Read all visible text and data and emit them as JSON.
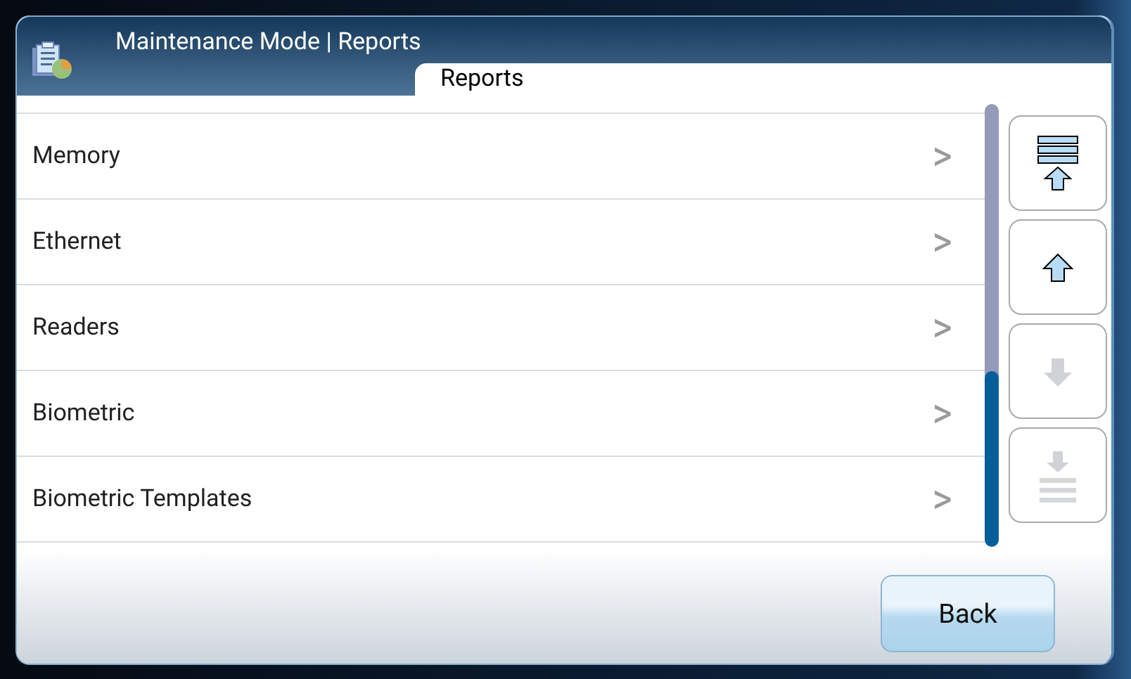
{
  "window": {
    "title": "Maintenance Mode | Reports"
  },
  "tabs": [
    {
      "label": "Reports",
      "selected": true
    }
  ],
  "list": {
    "items": [
      {
        "label": "Memory",
        "chevron": ">"
      },
      {
        "label": "Ethernet",
        "chevron": ">"
      },
      {
        "label": "Readers",
        "chevron": ">"
      },
      {
        "label": "Biometric",
        "chevron": ">"
      },
      {
        "label": "Biometric Templates",
        "chevron": ">"
      }
    ]
  },
  "scroll_buttons": [
    {
      "kind": "top",
      "disabled": false
    },
    {
      "kind": "up",
      "disabled": false
    },
    {
      "kind": "down",
      "disabled": true
    },
    {
      "kind": "bottom",
      "disabled": true
    }
  ],
  "buttons": [
    {
      "label": "Back"
    }
  ]
}
